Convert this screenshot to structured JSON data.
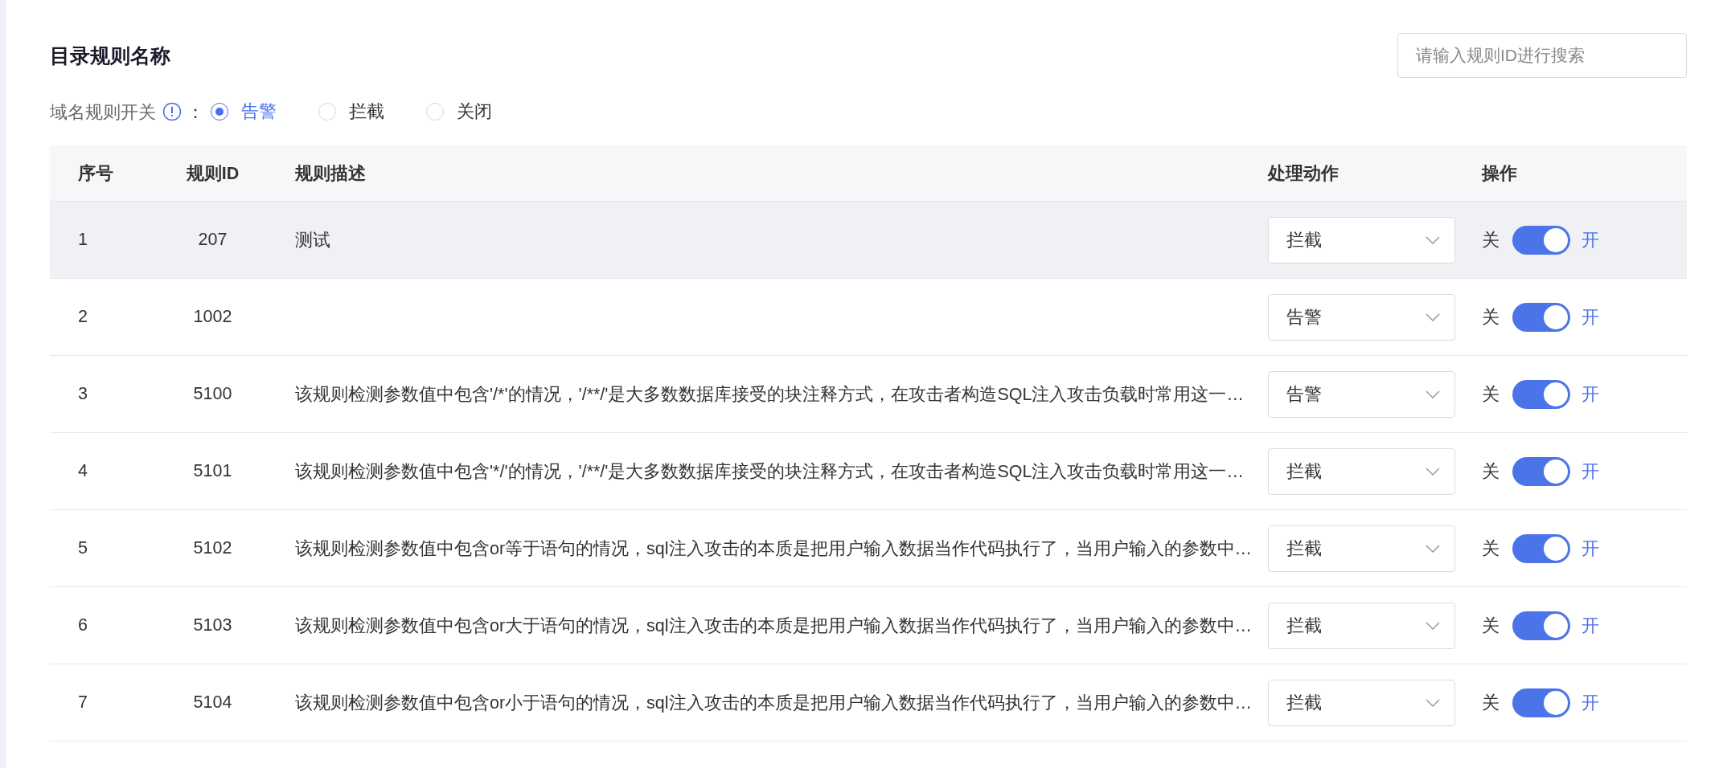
{
  "title": "目录规则名称",
  "search": {
    "placeholder": "请输入规则ID进行搜索"
  },
  "domain_switch": {
    "label": "域名规则开关",
    "separator": "：",
    "options": [
      {
        "label": "告警",
        "selected": true
      },
      {
        "label": "拦截",
        "selected": false
      },
      {
        "label": "关闭",
        "selected": false
      }
    ]
  },
  "table": {
    "columns": [
      "序号",
      "规则ID",
      "规则描述",
      "处理动作",
      "操作"
    ],
    "rows": [
      {
        "index": "1",
        "rule_id": "207",
        "description": "测试",
        "action": "拦截",
        "off_label": "关",
        "on_label": "开",
        "on": true,
        "highlighted": true
      },
      {
        "index": "2",
        "rule_id": "1002",
        "description": "",
        "action": "告警",
        "off_label": "关",
        "on_label": "开",
        "on": true,
        "highlighted": false
      },
      {
        "index": "3",
        "rule_id": "5100",
        "description": "该规则检测参数值中包含'/*'的情况，'/**/'是大多数数据库接受的块注释方式，在攻击者构造SQL注入攻击负载时常用这一…",
        "action": "告警",
        "off_label": "关",
        "on_label": "开",
        "on": true,
        "highlighted": false
      },
      {
        "index": "4",
        "rule_id": "5101",
        "description": "该规则检测参数值中包含'*/'的情况，'/**/'是大多数数据库接受的块注释方式，在攻击者构造SQL注入攻击负载时常用这一…",
        "action": "拦截",
        "off_label": "关",
        "on_label": "开",
        "on": true,
        "highlighted": false
      },
      {
        "index": "5",
        "rule_id": "5102",
        "description": "该规则检测参数值中包含or等于语句的情况，sql注入攻击的本质是把用户输入数据当作代码执行了，当用户输入的参数中…",
        "action": "拦截",
        "off_label": "关",
        "on_label": "开",
        "on": true,
        "highlighted": false
      },
      {
        "index": "6",
        "rule_id": "5103",
        "description": "该规则检测参数值中包含or大于语句的情况，sql注入攻击的本质是把用户输入数据当作代码执行了，当用户输入的参数中…",
        "action": "拦截",
        "off_label": "关",
        "on_label": "开",
        "on": true,
        "highlighted": false
      },
      {
        "index": "7",
        "rule_id": "5104",
        "description": "该规则检测参数值中包含or小于语句的情况，sql注入攻击的本质是把用户输入数据当作代码执行了，当用户输入的参数中…",
        "action": "拦截",
        "off_label": "关",
        "on_label": "开",
        "on": true,
        "highlighted": false
      }
    ]
  }
}
